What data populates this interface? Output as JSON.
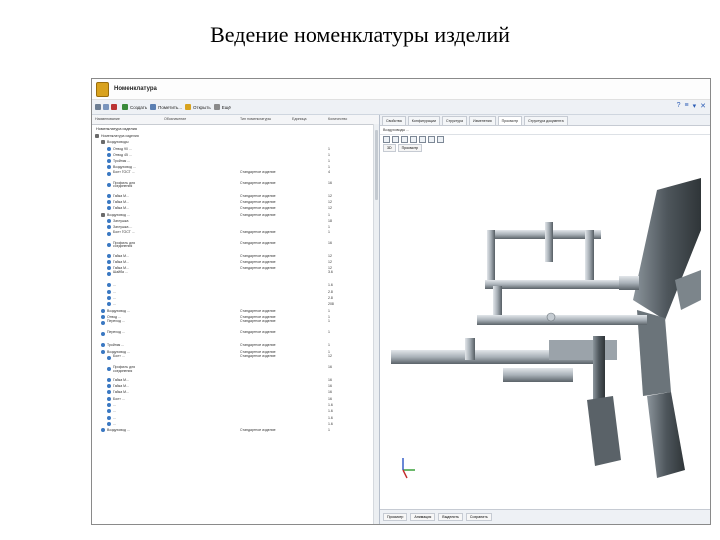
{
  "slide_title": "Ведение номенклатуры изделий",
  "app": {
    "title": "Номенклатура",
    "toolbar": {
      "create": "Создать",
      "set_deleted": "Пометить...",
      "open": "Открыть",
      "extra": "Ещё",
      "right_icons": [
        "?",
        "≡",
        "▾",
        "✕"
      ]
    },
    "columns": [
      "Наименование",
      "Обозначение",
      "Тип номенклатуры",
      "Единица",
      "Количество"
    ],
    "tree_header": "Номенклатура изделия",
    "rows": [
      {
        "indent": 0,
        "name": "Номенклатура изделия",
        "type": "",
        "qty": "",
        "kind": "blk"
      },
      {
        "indent": 1,
        "name": "Воздуховоды",
        "type": "",
        "qty": "",
        "kind": "blk"
      },
      {
        "indent": 2,
        "name": "Отвод 90 ...",
        "type": "",
        "qty": "1"
      },
      {
        "indent": 2,
        "name": "Отвод 45 ...",
        "type": "",
        "qty": "1"
      },
      {
        "indent": 2,
        "name": "Тройник ...",
        "type": "",
        "qty": "1"
      },
      {
        "indent": 2,
        "name": "Воздуховод ...",
        "type": "",
        "qty": "1"
      },
      {
        "indent": 2,
        "name": "Болт ГОСТ ...",
        "type": "Стандартное изделие",
        "qty": "4",
        "multi": true
      },
      {
        "indent": 2,
        "name": "Профиль для соединения",
        "type": "Стандартное изделие",
        "qty": "16",
        "multi": true
      },
      {
        "indent": 2,
        "name": "Гайка М...",
        "type": "Стандартное изделие",
        "qty": "12"
      },
      {
        "indent": 2,
        "name": "Гайка М...",
        "type": "Стандартное изделие",
        "qty": "12"
      },
      {
        "indent": 2,
        "name": "Гайка М...",
        "type": "Стандартное изделие",
        "qty": "12"
      },
      {
        "indent": 1,
        "name": "Воздуховод ...",
        "type": "Стандартное изделие",
        "qty": "1",
        "kind": "blk"
      },
      {
        "indent": 2,
        "name": "Заглушка",
        "type": "",
        "qty": "18"
      },
      {
        "indent": 2,
        "name": "Заглушка ...",
        "type": "",
        "qty": "1"
      },
      {
        "indent": 2,
        "name": "Болт ГОСТ ...",
        "type": "Стандартное изделие",
        "qty": "1",
        "multi": true
      },
      {
        "indent": 2,
        "name": "Профиль для соединения",
        "type": "Стандартное изделие",
        "qty": "16",
        "multi": true
      },
      {
        "indent": 2,
        "name": "Гайка М...",
        "type": "Стандартное изделие",
        "qty": "12"
      },
      {
        "indent": 2,
        "name": "Гайка М...",
        "type": "Стандартное изделие",
        "qty": "12"
      },
      {
        "indent": 2,
        "name": "Гайка М...",
        "type": "Стандартное изделие",
        "qty": "12"
      },
      {
        "indent": 2,
        "name": "Шайба ...",
        "type": "",
        "qty": "3.6",
        "multi": true
      },
      {
        "indent": 2,
        "name": "...",
        "type": "",
        "qty": "1.6"
      },
      {
        "indent": 2,
        "name": "...",
        "type": "",
        "qty": "2.8"
      },
      {
        "indent": 2,
        "name": "...",
        "type": "",
        "qty": "2.8"
      },
      {
        "indent": 2,
        "name": "...",
        "type": "",
        "qty": "208"
      },
      {
        "indent": 1,
        "name": "Воздуховод ...",
        "type": "Стандартное изделие",
        "qty": "1"
      },
      {
        "indent": 1,
        "name": "Отвод ...",
        "type": "Стандартное изделие",
        "qty": "1"
      },
      {
        "indent": 1,
        "name": "Переход ...",
        "type": "Стандартное изделие",
        "qty": "1",
        "multi": true
      },
      {
        "indent": 1,
        "name": "Переход ...",
        "type": "Стандартное изделие",
        "qty": "1",
        "multi": true
      },
      {
        "indent": 1,
        "name": "Тройник ...",
        "type": "Стандартное изделие",
        "qty": "1"
      },
      {
        "indent": 1,
        "name": "Воздуховод ...",
        "type": "Стандартное изделие",
        "qty": "1"
      },
      {
        "indent": 2,
        "name": "Болт ...",
        "type": "Стандартное изделие",
        "qty": "12",
        "multi": true
      },
      {
        "indent": 2,
        "name": "Профиль для соединения",
        "type": "",
        "qty": "16",
        "multi": true
      },
      {
        "indent": 2,
        "name": "Гайка М...",
        "type": "",
        "qty": "16"
      },
      {
        "indent": 2,
        "name": "Гайка М...",
        "type": "",
        "qty": "16"
      },
      {
        "indent": 2,
        "name": "Гайка М...",
        "type": "",
        "qty": "16"
      },
      {
        "indent": 2,
        "name": "Болт ...",
        "type": "",
        "qty": "16"
      },
      {
        "indent": 2,
        "name": "...",
        "type": "",
        "qty": "1.6"
      },
      {
        "indent": 2,
        "name": "...",
        "type": "",
        "qty": "1.6"
      },
      {
        "indent": 2,
        "name": "...",
        "type": "",
        "qty": "1.6"
      },
      {
        "indent": 2,
        "name": "...",
        "type": "",
        "qty": "1.6"
      },
      {
        "indent": 1,
        "name": "Воздуховод ...",
        "type": "Стандартное изделие",
        "qty": "1"
      }
    ],
    "right_tabs": [
      "Свойства",
      "Конфигурации",
      "Структура",
      "Изменения",
      "Просмотр",
      "Структура документа"
    ],
    "right_active_tab": 4,
    "subhead": "Воздуховоды ...",
    "mini_tabs": [
      "3D",
      "Просмотр"
    ],
    "bottom_tabs": [
      "Просмотр",
      "Анимация",
      "Выделить",
      "Сохранить"
    ],
    "colors": {
      "duct_light": "#c9d0d6",
      "duct_mid": "#9aa3ab",
      "duct_dark": "#4e565c",
      "tree_icon": "#3a78c2",
      "titlebar_logo": "#d9a21e"
    }
  }
}
